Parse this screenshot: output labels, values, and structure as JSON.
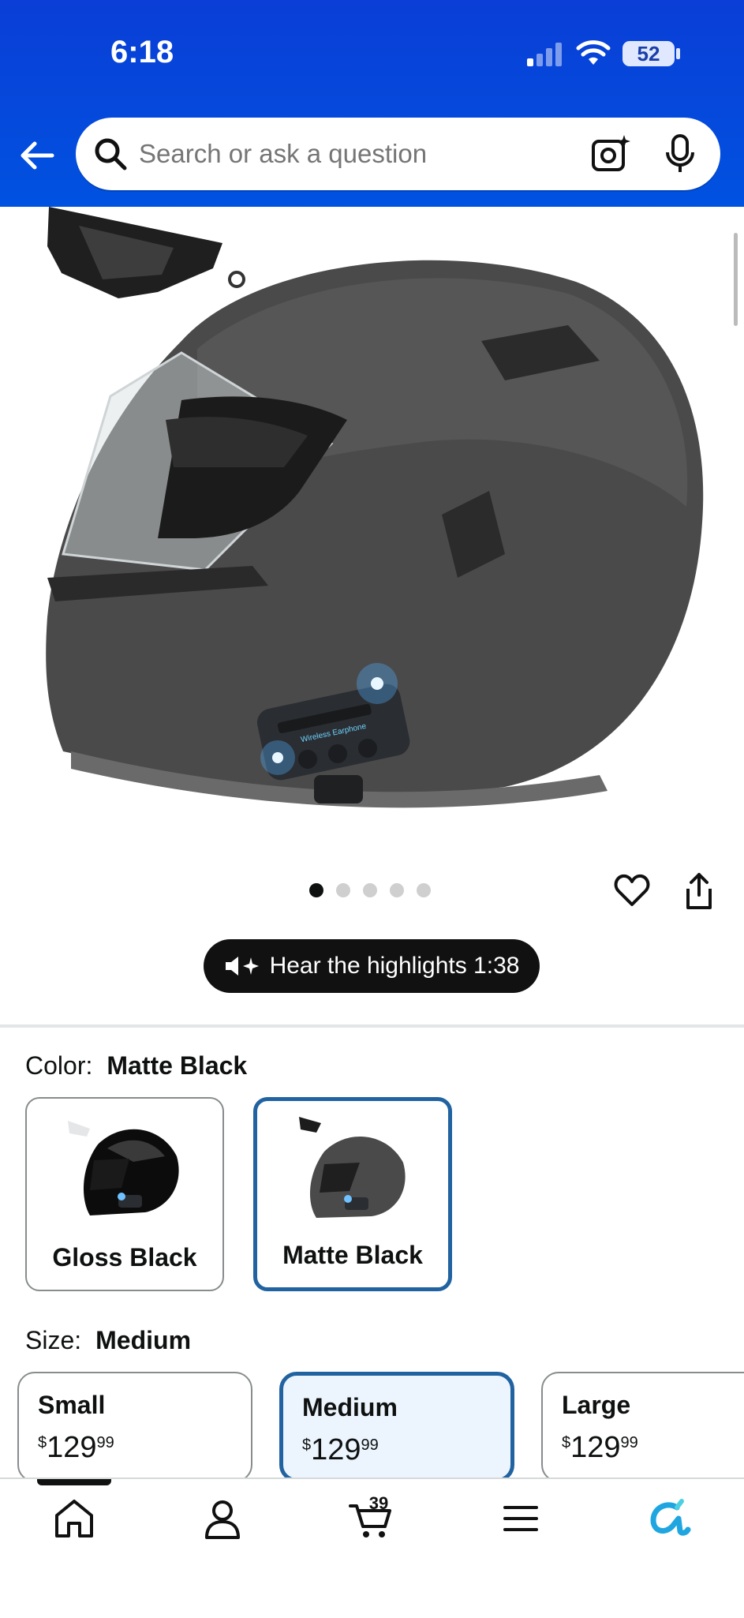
{
  "status_bar": {
    "time": "6:18",
    "battery": "52"
  },
  "header": {
    "search_placeholder": "Search or ask a question"
  },
  "carousel": {
    "dot_count": 5,
    "active_index": 0
  },
  "audio": {
    "label": "Hear the highlights 1:38"
  },
  "color": {
    "label": "Color:",
    "selected": "Matte Black",
    "options": [
      {
        "name": "Gloss Black"
      },
      {
        "name": "Matte Black"
      }
    ]
  },
  "size": {
    "label": "Size:",
    "selected": "Medium",
    "options": [
      {
        "name": "Small",
        "currency": "$",
        "whole": "129",
        "fraction": "99"
      },
      {
        "name": "Medium",
        "currency": "$",
        "whole": "129",
        "fraction": "99"
      },
      {
        "name": "Large",
        "currency": "$",
        "whole": "129",
        "fraction": "99"
      }
    ]
  },
  "tabbar": {
    "cart_count": "39"
  },
  "colors": {
    "header_blue": "#0a3ed6",
    "selected_border": "#2162a1",
    "selected_fill": "#ecf5fe"
  }
}
